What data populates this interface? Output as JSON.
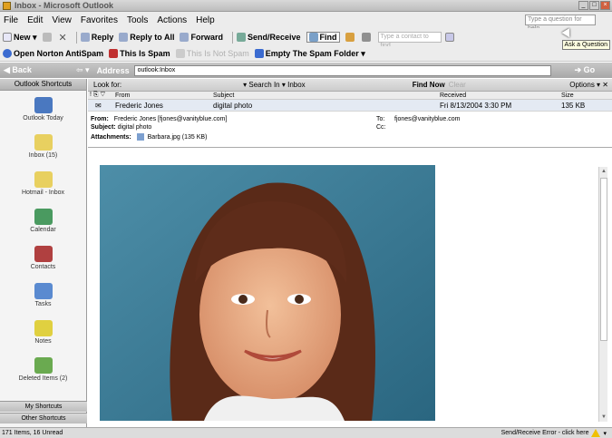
{
  "window": {
    "title": "Inbox - Microsoft Outlook"
  },
  "menu": {
    "items": [
      "File",
      "Edit",
      "View",
      "Favorites",
      "Tools",
      "Actions",
      "Help"
    ],
    "help_placeholder": "Type a question for help"
  },
  "toolbar1": {
    "new": "New",
    "reply": "Reply",
    "reply_all": "Reply to All",
    "forward": "Forward",
    "send_receive": "Send/Receive",
    "find": "Find",
    "contact_placeholder": "Type a contact to find",
    "tooltip": "Ask a Question"
  },
  "toolbar2": {
    "norton": "Open Norton AntiSpam",
    "spam": "This Is Spam",
    "not_spam": "This Is Not Spam",
    "empty": "Empty The Spam Folder"
  },
  "navbar": {
    "back": "Back",
    "address_label": "Address",
    "address_value": "outlook:Inbox",
    "go": "Go"
  },
  "sidebar": {
    "header": "Outlook Shortcuts",
    "items": [
      {
        "label": "Outlook Today",
        "icon": "outlook-today-icon",
        "color": "#4a78c0"
      },
      {
        "label": "Inbox (15)",
        "icon": "inbox-icon",
        "color": "#e8d060"
      },
      {
        "label": "Hotmail - Inbox",
        "icon": "hotmail-icon",
        "color": "#e8d060"
      },
      {
        "label": "Calendar",
        "icon": "calendar-icon",
        "color": "#4a9a60"
      },
      {
        "label": "Contacts",
        "icon": "contacts-icon",
        "color": "#b04040"
      },
      {
        "label": "Tasks",
        "icon": "tasks-icon",
        "color": "#5a8ad0"
      },
      {
        "label": "Notes",
        "icon": "notes-icon",
        "color": "#e0d040"
      },
      {
        "label": "Deleted Items (2)",
        "icon": "deleted-icon",
        "color": "#6aaa50"
      }
    ],
    "my_shortcuts": "My Shortcuts",
    "other_shortcuts": "Other Shortcuts"
  },
  "findbar": {
    "look_for": "Look for:",
    "search_in": "Search In",
    "search_value": "Inbox",
    "find_now": "Find Now",
    "clear": "Clear",
    "options": "Options"
  },
  "list": {
    "headers": {
      "from": "From",
      "subject": "Subject",
      "received": "Received",
      "size": "Size"
    },
    "row": {
      "from": "Frederic Jones",
      "subject": "digital photo",
      "received": "Fri 8/13/2004 3:30 PM",
      "size": "135 KB"
    }
  },
  "reading": {
    "from_label": "From:",
    "from_value": "Frederic Jones [fjones@vanityblue.com]",
    "to_label": "To:",
    "to_value": "fjones@vanityblue.com",
    "subject_label": "Subject:",
    "subject_value": "digital photo",
    "cc_label": "Cc:",
    "attachments_label": "Attachments:",
    "attachment_name": "Barbara.jpg (135 KB)"
  },
  "status": {
    "items": "171 Items, 16 Unread",
    "send_receive": "Send/Receive Error - click here"
  }
}
